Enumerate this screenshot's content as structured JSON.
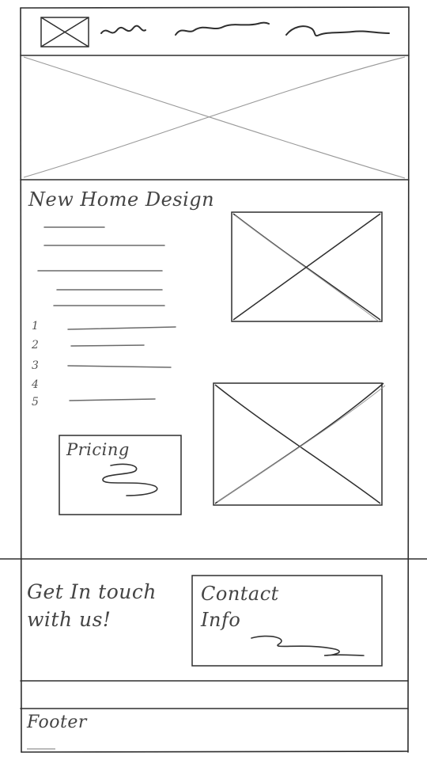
{
  "content": {
    "title": "New Home Design",
    "list_numbers": [
      "1",
      "2",
      "3",
      "4",
      "5"
    ]
  },
  "pricing": {
    "title": "Pricing"
  },
  "contact": {
    "heading": "Get In touch with us!",
    "box_title": "Contact Info"
  },
  "footer": {
    "label": "Footer"
  },
  "colors": {
    "ink": "#333333",
    "light_ink": "#9a9a9a",
    "paper": "#ffffff"
  }
}
